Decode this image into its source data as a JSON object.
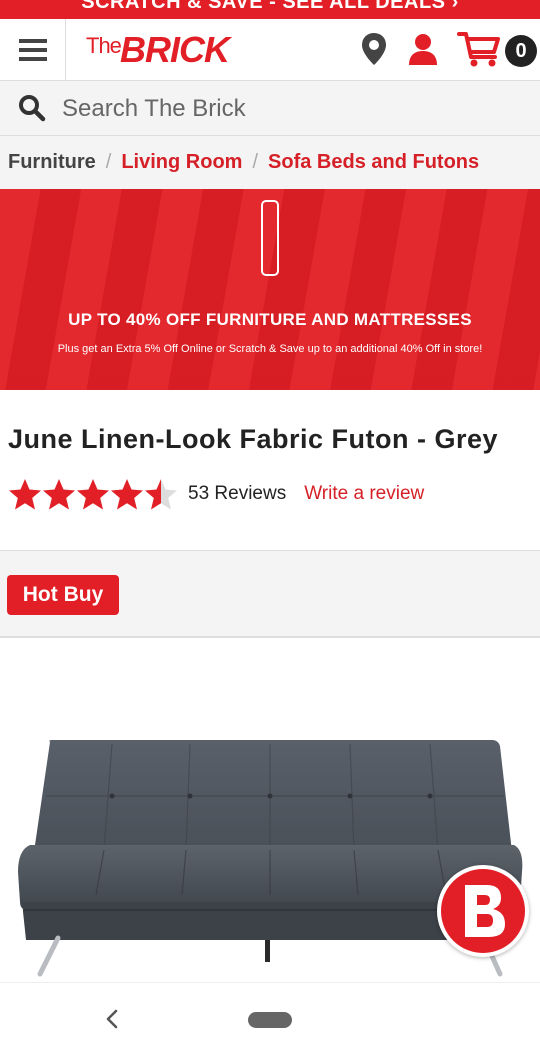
{
  "promo_strip": {
    "text": "SCRATCH & SAVE - SEE ALL DEALS ›"
  },
  "header": {
    "logo_the": "The",
    "logo_brick": "BRICK",
    "cart_count": "0",
    "icons": [
      "menu-icon",
      "location-pin-icon",
      "account-icon",
      "cart-icon"
    ]
  },
  "search": {
    "placeholder": "Search The Brick"
  },
  "breadcrumb": {
    "root": "Furniture",
    "separator": "/",
    "items": [
      "Living Room",
      "Sofa Beds and Futons"
    ]
  },
  "banner": {
    "title": "UP TO 40% OFF FURNITURE AND MATTRESSES",
    "subtitle": "Plus get an Extra 5% Off Online or Scratch & Save up to an additional 40% Off in store!"
  },
  "product": {
    "title": "June Linen-Look Fabric Futon - Grey",
    "rating": 4.5,
    "rating_max": 5,
    "reviews_label": "53 Reviews",
    "write_review_label": "Write a review",
    "badge": "Hot Buy"
  },
  "colors": {
    "brand_red": "#e21f26",
    "link_red": "#d52027",
    "text_dark": "#222222",
    "panel_grey": "#f4f4f4"
  }
}
